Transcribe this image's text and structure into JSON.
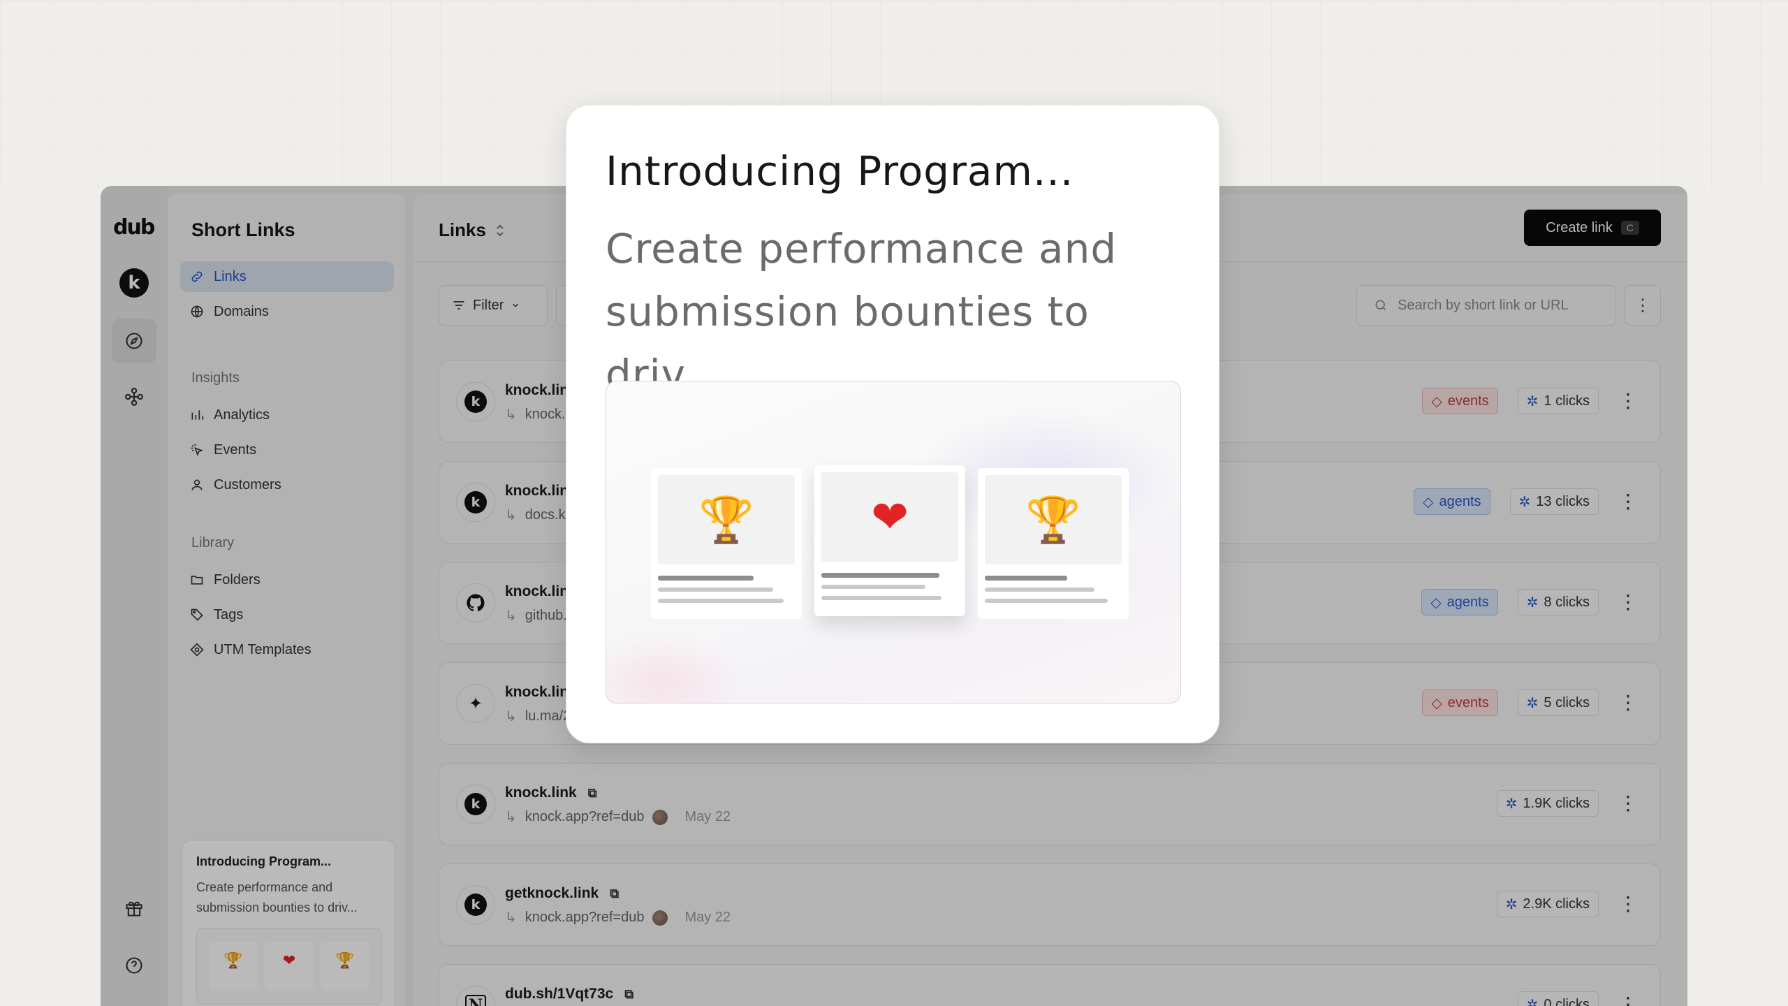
{
  "app": {
    "logo": "dub",
    "avatar_letter": "k"
  },
  "sidebar": {
    "title": "Short Links",
    "items": [
      {
        "label": "Links",
        "icon": "link-icon",
        "active": true
      },
      {
        "label": "Domains",
        "icon": "globe-icon"
      }
    ],
    "insights_label": "Insights",
    "insights": [
      {
        "label": "Analytics",
        "icon": "bar-chart-icon"
      },
      {
        "label": "Events",
        "icon": "cursor-click-icon"
      },
      {
        "label": "Customers",
        "icon": "user-icon"
      }
    ],
    "library_label": "Library",
    "library": [
      {
        "label": "Folders",
        "icon": "folder-icon"
      },
      {
        "label": "Tags",
        "icon": "tag-icon"
      },
      {
        "label": "UTM Templates",
        "icon": "diamond-icon"
      }
    ],
    "promo": {
      "title": "Introducing Program...",
      "desc": "Create performance and submission bounties to driv..."
    }
  },
  "header": {
    "title": "Links",
    "create_label": "Create link",
    "create_kbd": "C"
  },
  "toolbar": {
    "filter_label": "Filter",
    "search_placeholder": "Search by short link or URL"
  },
  "links": [
    {
      "short": "knock.lin",
      "dest": "knock.",
      "tag": "events",
      "clicks": "1 clicks",
      "icon": "k"
    },
    {
      "short": "knock.lin",
      "dest": "docs.k",
      "tag": "agents",
      "clicks": "13 clicks",
      "icon": "k"
    },
    {
      "short": "knock.lin",
      "dest": "github.",
      "tag": "agents",
      "clicks": "8 clicks",
      "icon": "github"
    },
    {
      "short": "knock.lin",
      "dest": "lu.ma/2",
      "tag": "events",
      "clicks": "5 clicks",
      "icon": "sparkle"
    },
    {
      "short": "knock.link",
      "dest": "knock.app?ref=dub",
      "date": "May 22",
      "clicks": "1.9K clicks",
      "icon": "k"
    },
    {
      "short": "getknock.link",
      "dest": "knock.app?ref=dub",
      "date": "May 22",
      "clicks": "2.9K clicks",
      "icon": "k"
    },
    {
      "short": "dub.sh/1Vqt73c",
      "dest": "",
      "clicks": "0 clicks",
      "icon": "notion"
    }
  ],
  "modal": {
    "title": "Introducing Program...",
    "desc": "Create performance and submission bounties to driv..."
  },
  "colors": {
    "accent": "#2656c9",
    "events_tag": "#c23a3a",
    "agents_tag": "#2d5bc4"
  }
}
